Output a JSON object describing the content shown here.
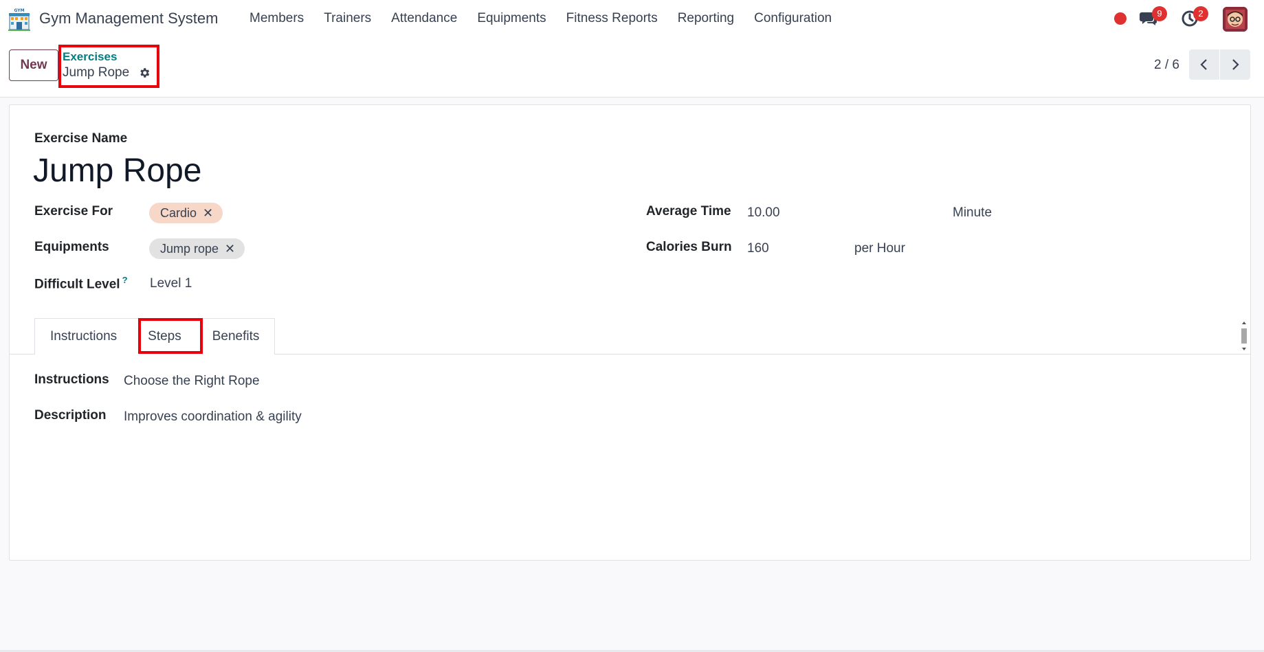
{
  "navbar": {
    "app_title": "Gym Management System",
    "menu": [
      "Members",
      "Trainers",
      "Attendance",
      "Equipments",
      "Fitness Reports",
      "Reporting",
      "Configuration"
    ],
    "messages_count": "9",
    "activities_count": "2",
    "logo_text": "GYM"
  },
  "control_panel": {
    "new_label": "New",
    "breadcrumb_parent": "Exercises",
    "breadcrumb_current": "Jump Rope",
    "pager_value": "2 / 6"
  },
  "form": {
    "name_label": "Exercise Name",
    "name_value": "Jump Rope",
    "exercise_for_label": "Exercise For",
    "exercise_for_tags": [
      "Cardio"
    ],
    "equipments_label": "Equipments",
    "equipments_tags": [
      "Jump rope"
    ],
    "difficulty_label": "Difficult Level",
    "difficulty_help": "?",
    "difficulty_value": "Level 1",
    "avg_time_label": "Average Time",
    "avg_time_value": "10.00",
    "avg_time_unit": "Minute",
    "calories_label": "Calories Burn",
    "calories_value": "160",
    "calories_unit": "per Hour"
  },
  "tabs": {
    "items": [
      "Instructions",
      "Steps",
      "Benefits"
    ],
    "active": "Steps"
  },
  "steps_page": {
    "instructions_label": "Instructions",
    "instructions_value": "Choose the Right Rope",
    "description_label": "Description",
    "description_value": "Improves coordination & agility"
  },
  "colors": {
    "brand": "#71394f",
    "link": "#017e84",
    "highlight": "#e8000b",
    "badge": "#e03131",
    "tag_cardio": "#f7d7c8",
    "tag_neutral": "#e2e2e2"
  },
  "icons": {
    "app": "gym-building-icon",
    "settings": "gear-icon",
    "messages": "chat-bubbles-icon",
    "activities": "clock-icon",
    "pager_prev": "chevron-left-icon",
    "pager_next": "chevron-right-icon",
    "remove_tag": "close-icon"
  }
}
